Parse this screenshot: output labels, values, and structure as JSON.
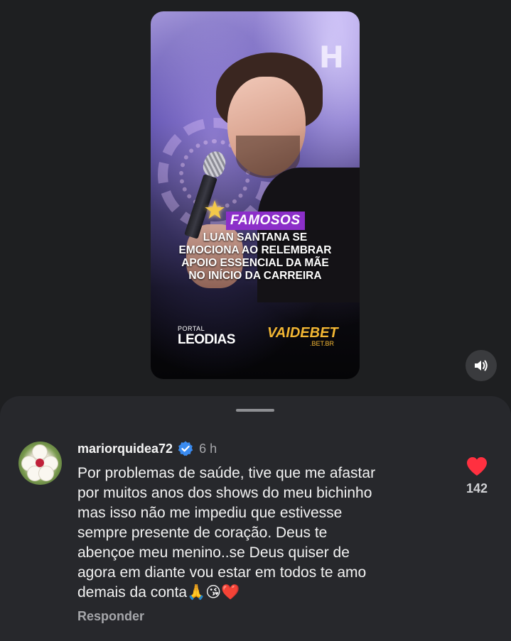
{
  "video": {
    "category": "FAMOSOS",
    "headline_lines": [
      "LUAN SANTANA SE",
      "EMOCIONA AO RELEMBRAR",
      "APOIO ESSENCIAL DA MÃE",
      "NO INÍCIO DA CARREIRA"
    ],
    "backdrop_letter": "H",
    "brand_left_small": "PORTAL",
    "brand_left_big": "LEODIAS",
    "brand_right_big": "VAIDEBET",
    "brand_right_small": ".BET.BR"
  },
  "sound_button": {
    "icon": "speaker-icon"
  },
  "comment": {
    "username": "mariorquidea72",
    "verified": true,
    "time": "6 h",
    "text": "Por problemas de saúde, tive que me afastar\npor muitos anos dos shows do meu bichinho\nmas isso não me impediu que estivesse\nsempre presente de coração. Deus te\nabençoe meu menino..se Deus quiser de\nagora em diante vou estar em todos te amo\ndemais da conta🙏😘❤️",
    "reply_label": "Responder",
    "like_count": "142",
    "like_color": "#ff3040"
  },
  "colors": {
    "category_tag": "#8c2fc9",
    "brand_right": "#f2b633",
    "verified_badge": "#3a8bf0"
  }
}
